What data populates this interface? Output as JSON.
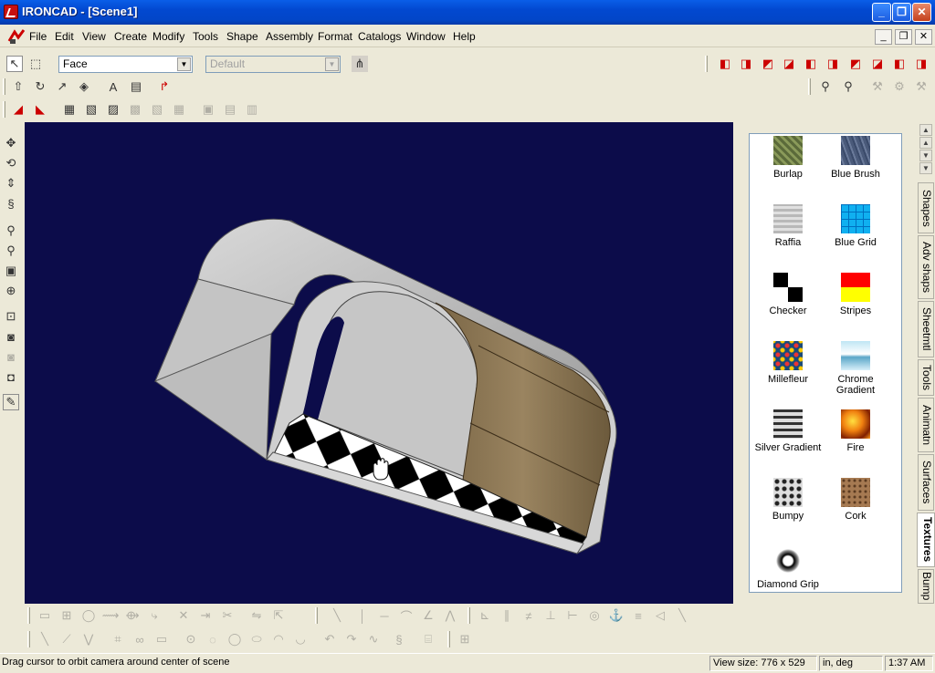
{
  "window": {
    "title": "IRONCAD - [Scene1]",
    "minimize": "_",
    "restore": "❐",
    "close": "✕"
  },
  "menu": [
    "File",
    "Edit",
    "View",
    "Create",
    "Modify",
    "Tools",
    "Shape",
    "Assembly",
    "Format",
    "Catalogs",
    "Window",
    "Help"
  ],
  "mdi_controls": {
    "minimize": "_",
    "restore": "❐",
    "close": "✕"
  },
  "toolbar": {
    "selection_filter": "Face",
    "style_combo": "Default"
  },
  "catalog": {
    "items": [
      {
        "label": "Burlap",
        "swatch": "burlap"
      },
      {
        "label": "Blue Brush",
        "swatch": "blue-brush"
      },
      {
        "label": "Raffia",
        "swatch": "raffia"
      },
      {
        "label": "Blue Grid",
        "swatch": "blue-grid"
      },
      {
        "label": "Checker",
        "swatch": "checker"
      },
      {
        "label": "Stripes",
        "swatch": "stripes"
      },
      {
        "label": "Millefleur",
        "swatch": "millefleur"
      },
      {
        "label": "Chrome Gradient",
        "swatch": "chrome-gradient"
      },
      {
        "label": "Silver Gradient",
        "swatch": "silver-gradient"
      },
      {
        "label": "Fire",
        "swatch": "fire"
      },
      {
        "label": "Bumpy",
        "swatch": "bumpy"
      },
      {
        "label": "Cork",
        "swatch": "cork"
      },
      {
        "label": "Diamond Grip",
        "swatch": "diamond-grip"
      }
    ]
  },
  "tabs": [
    "Shapes",
    "Adv shaps",
    "Sheetmtl",
    "Tools",
    "Animatn",
    "Surfaces",
    "Textures",
    "Bump"
  ],
  "active_tab": "Textures",
  "status": {
    "message": "Drag cursor to orbit camera around center of scene",
    "view_size": "View size:  776 x  529",
    "units": "in, deg",
    "time": "1:37 AM"
  },
  "colors": {
    "viewport_bg": "#0c0c4a",
    "titlebar": "#0248d0",
    "wood": "#8a7452"
  }
}
